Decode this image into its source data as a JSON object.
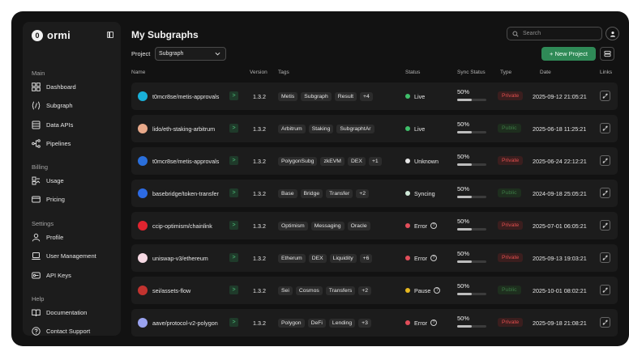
{
  "brand": {
    "logo_mark": "0",
    "name": "ormi"
  },
  "sidebar": {
    "sections": [
      {
        "title": "Main",
        "items": [
          {
            "label": "Dashboard",
            "icon": "grid-icon"
          },
          {
            "label": "Subgraph",
            "icon": "code-braces-icon"
          },
          {
            "label": "Data APIs",
            "icon": "database-icon"
          },
          {
            "label": "Pipelines",
            "icon": "pipeline-icon"
          }
        ]
      },
      {
        "title": "Billing",
        "items": [
          {
            "label": "Usage",
            "icon": "usage-icon"
          },
          {
            "label": "Pricing",
            "icon": "card-icon"
          }
        ]
      },
      {
        "title": "Settings",
        "items": [
          {
            "label": "Profile",
            "icon": "user-icon"
          },
          {
            "label": "User Management",
            "icon": "laptop-icon"
          },
          {
            "label": "API Keys",
            "icon": "key-icon"
          }
        ]
      },
      {
        "title": "Help",
        "items": [
          {
            "label": "Documentation",
            "icon": "book-icon"
          },
          {
            "label": "Contact Support",
            "icon": "help-circle-icon"
          }
        ]
      }
    ]
  },
  "header": {
    "title": "My Subgraphs",
    "search_placeholder": "Search",
    "project_label": "Project",
    "project_value": "Subgraph",
    "new_project_label": "+ New Project"
  },
  "table": {
    "columns": [
      "Name",
      "Version",
      "Tags",
      "Status",
      "Sync Status",
      "Type",
      "Date",
      "Links"
    ],
    "rows": [
      {
        "name": "t0mcr8se/metis-approvals",
        "icon_color": "#19b0d8",
        "version": "1.3.2",
        "tags": [
          "Metis",
          "Subgraph",
          "Result",
          "+4"
        ],
        "status": "Live",
        "status_color": "#3fbf6a",
        "status_help": false,
        "sync": "50%",
        "sync_fraction": 0.5,
        "type": "Private",
        "date": "2025-09-12 21:05:21"
      },
      {
        "name": "lido/eth-staking-arbitrum",
        "icon_color": "#e8a98a",
        "version": "1.3.2",
        "tags": [
          "Arbitrum",
          "Staking",
          "SubgraphtAr"
        ],
        "status": "Live",
        "status_color": "#3fbf6a",
        "status_help": false,
        "sync": "50%",
        "sync_fraction": 0.5,
        "type": "Public",
        "date": "2025-06-18 11:25:21"
      },
      {
        "name": "t0mcr8se/metis-approvals",
        "icon_color": "#2a6fdb",
        "version": "1.3.2",
        "tags": [
          "PolygonSubg",
          "zkEVM",
          "DEX",
          "+1"
        ],
        "status": "Unknown",
        "status_color": "#e6e6e6",
        "status_help": false,
        "sync": "50%",
        "sync_fraction": 0.5,
        "type": "Private",
        "date": "2025-06-24 22:12:21"
      },
      {
        "name": "basebridge/token-transfer",
        "icon_color": "#2d6be4",
        "version": "1.3.2",
        "tags": [
          "Base",
          "Bridge",
          "Transfer",
          "+2"
        ],
        "status": "Syncing",
        "status_color": "#cfe8d8",
        "status_help": false,
        "sync": "50%",
        "sync_fraction": 0.5,
        "type": "Public",
        "date": "2024-09-18 25:05:21"
      },
      {
        "name": "ccip-optimism/chainlink",
        "icon_color": "#e0242f",
        "version": "1.3.2",
        "tags": [
          "Optimism",
          "Messaging",
          "Oracle"
        ],
        "status": "Error",
        "status_color": "#e24e5a",
        "status_help": true,
        "sync": "50%",
        "sync_fraction": 0.5,
        "type": "Private",
        "date": "2025-07-01 06:05:21"
      },
      {
        "name": "uniswap-v3/ethereum",
        "icon_color": "#f6d9e3",
        "version": "1.3.2",
        "tags": [
          "Etherum",
          "DEX",
          "Liquidity",
          "+6"
        ],
        "status": "Error",
        "status_color": "#e24e5a",
        "status_help": true,
        "sync": "50%",
        "sync_fraction": 0.5,
        "type": "Private",
        "date": "2025-09-13 19:03:21"
      },
      {
        "name": "sei/assets-flow",
        "icon_color": "#c2332f",
        "version": "1.3.2",
        "tags": [
          "Sei",
          "Cosmos",
          "Transfers",
          "+2"
        ],
        "status": "Pause",
        "status_color": "#e7b820",
        "status_help": true,
        "sync": "50%",
        "sync_fraction": 0.5,
        "type": "Public",
        "date": "2025-10-01 08:02:21"
      },
      {
        "name": "aave/protocol-v2-polygon",
        "icon_color": "#9aa3f0",
        "version": "1.3.2",
        "tags": [
          "Polygon",
          "DeFi",
          "Lending",
          "+3"
        ],
        "status": "Error",
        "status_color": "#e24e5a",
        "status_help": true,
        "sync": "50%",
        "sync_fraction": 0.5,
        "type": "Private",
        "date": "2025-09-18 21:08:21"
      }
    ]
  }
}
